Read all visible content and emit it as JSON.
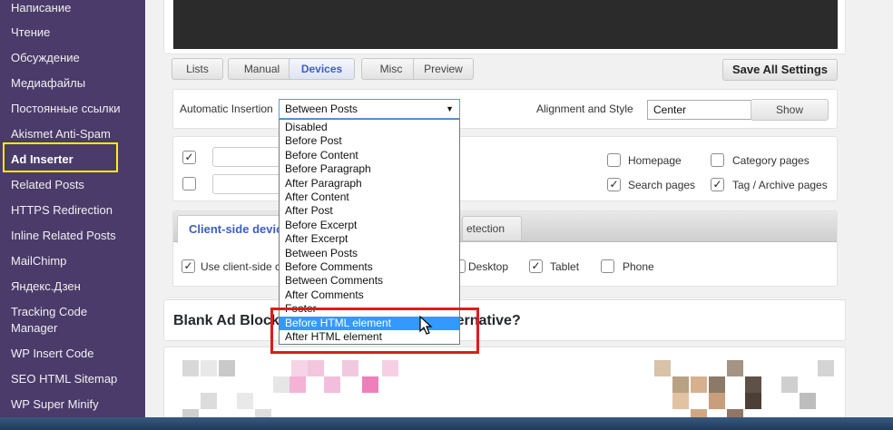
{
  "sidebar": {
    "items": [
      {
        "label": "Написание"
      },
      {
        "label": "Чтение"
      },
      {
        "label": "Обсуждение"
      },
      {
        "label": "Медиафайлы"
      },
      {
        "label": "Постоянные ссылки"
      },
      {
        "label": "Akismet Anti-Spam"
      },
      {
        "label": "Ad Inserter",
        "active": true
      },
      {
        "label": "Related Posts"
      },
      {
        "label": "HTTPS Redirection"
      },
      {
        "label": "Inline Related Posts"
      },
      {
        "label": "MailChimp"
      },
      {
        "label": "Яндекс.Дзен"
      },
      {
        "label": "Tracking Code"
      },
      {
        "label": "Manager"
      },
      {
        "label": "WP Insert Code"
      },
      {
        "label": "SEO HTML Sitemap"
      },
      {
        "label": "WP Super Minify"
      }
    ]
  },
  "tabs": {
    "lists": "Lists",
    "manual": "Manual",
    "devices": "Devices",
    "misc": "Misc",
    "preview": "Preview",
    "save_all": "Save All Settings"
  },
  "insertion": {
    "label": "Automatic Insertion",
    "value": "Between Posts",
    "align_label": "Alignment and Style",
    "align_value": "Center",
    "show_button": "Show"
  },
  "filters": {
    "homepage": "Homepage",
    "category": "Category pages",
    "search": "Search pages",
    "tag": "Tag / Archive pages"
  },
  "devices": {
    "tab_client": "Client-side devic",
    "tab_server": "etection",
    "use_client": "Use client-side c",
    "desktop": "Desktop",
    "tablet": "Tablet",
    "phone": "Phone"
  },
  "block": {
    "title_left": "Blank Ad Blocks",
    "title_right": "ernative?"
  },
  "dropdown": {
    "options": [
      "Disabled",
      "Before Post",
      "Before Content",
      "Before Paragraph",
      "After Paragraph",
      "After Content",
      "After Post",
      "Before Excerpt",
      "After Excerpt",
      "Between Posts",
      "Before Comments",
      "Between Comments",
      "After Comments",
      "Footer",
      "Before HTML element",
      "After HTML element"
    ],
    "highlighted_index": 14
  },
  "colors": {
    "sidebar": "#4b3b6a",
    "accent": "#3c5ec2",
    "highlight": "#3399ff",
    "yellow_box": "#ffef00",
    "red_box": "#e01b1b"
  }
}
